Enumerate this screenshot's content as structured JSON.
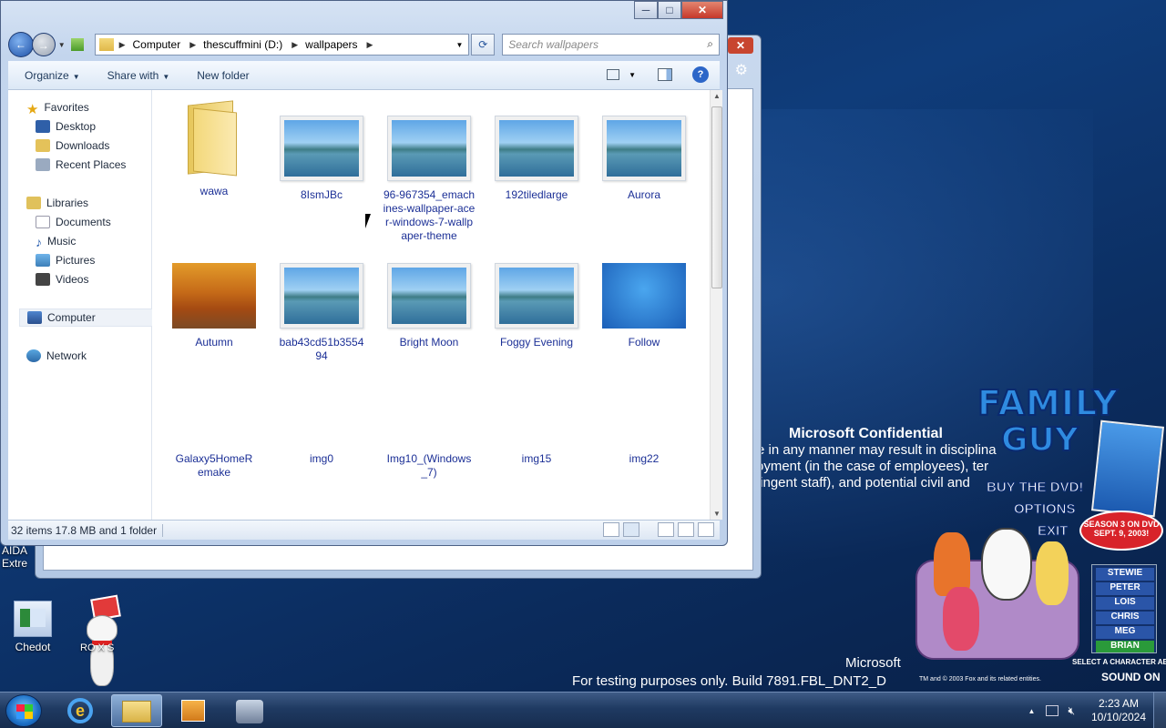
{
  "explorer": {
    "address": {
      "segments": [
        "Computer",
        "thescuffmini (D:)",
        "wallpapers"
      ]
    },
    "search": {
      "placeholder": "Search wallpapers"
    },
    "toolbar": {
      "organize": "Organize",
      "share_with": "Share with",
      "new_folder": "New folder"
    },
    "nav": {
      "favorites": "Favorites",
      "desktop": "Desktop",
      "downloads": "Downloads",
      "recent_places": "Recent Places",
      "libraries": "Libraries",
      "documents": "Documents",
      "music": "Music",
      "pictures": "Pictures",
      "videos": "Videos",
      "computer": "Computer",
      "network": "Network"
    },
    "items": [
      {
        "name": "wawa",
        "kind": "folder"
      },
      {
        "name": "8IsmJBc",
        "kind": "sea"
      },
      {
        "name": "96-967354_emachines-wallpaper-acer-windows-7-wallpaper-theme",
        "kind": "sea"
      },
      {
        "name": "192tiledlarge",
        "kind": "sea"
      },
      {
        "name": "Aurora",
        "kind": "sea"
      },
      {
        "name": "Autumn",
        "kind": "autumn"
      },
      {
        "name": "bab43cd51b355494",
        "kind": "sea"
      },
      {
        "name": "Bright Moon",
        "kind": "sea"
      },
      {
        "name": "Foggy Evening",
        "kind": "sea"
      },
      {
        "name": "Follow",
        "kind": "fish"
      },
      {
        "name": "Galaxy5HomeRemake",
        "kind": "none"
      },
      {
        "name": "img0",
        "kind": "none"
      },
      {
        "name": "Img10_(Windows_7)",
        "kind": "none"
      },
      {
        "name": "img15",
        "kind": "none"
      },
      {
        "name": "img22",
        "kind": "none"
      }
    ],
    "status": "32 items 17.8 MB and 1 folder"
  },
  "desktop": {
    "icons": {
      "chedot": "Chedot",
      "roblox": "RO  X S",
      "aida": "AIDA Extre"
    },
    "watermark": {
      "title": "Microsoft Confidential",
      "line1": "re in any manner may result in disciplina",
      "line2": "oyment (in the case of employees), ter",
      "line3": "tingent staff), and potential civil and",
      "line4": "Microsoft",
      "line5": "For testing purposes only. Build 7891.FBL_DNT2_D"
    },
    "promo": {
      "brand1": "FAMILY",
      "brand2": "GUY",
      "menu": [
        "BUY THE DVD!",
        "OPTIONS",
        "EXIT"
      ],
      "season": "SEASON 3 ON DVD SEPT. 9, 2003!",
      "characters": [
        "STEWIE",
        "PETER",
        "LOIS",
        "CHRIS",
        "MEG",
        "BRIAN"
      ],
      "select_hint": "SELECT A CHARACTER ABOVE",
      "sound": "SOUND ON",
      "copyright": "TM and © 2003 Fox and its related entities."
    }
  },
  "taskbar": {
    "time": "2:23 AM",
    "date": "10/10/2024"
  },
  "colors": {
    "desktop": "#0f3c7a",
    "link_text": "#1b2f96",
    "close_button": "#c6382a"
  }
}
